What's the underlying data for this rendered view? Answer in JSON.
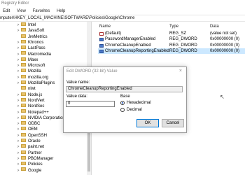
{
  "window": {
    "title": "Registry Editor"
  },
  "menu": [
    "Edit",
    "View",
    "Favorites",
    "Help"
  ],
  "address": "mputer\\HKEY_LOCAL_MACHINE\\SOFTWARE\\Policies\\Google\\Chrome",
  "tree": {
    "items": [
      {
        "label": "Intel",
        "expandable": true
      },
      {
        "label": "JavaSoft",
        "expandable": true
      },
      {
        "label": "JreMetrics",
        "expandable": false
      },
      {
        "label": "Khronos",
        "expandable": true
      },
      {
        "label": "LastPass",
        "expandable": true
      },
      {
        "label": "Macromedia",
        "expandable": true
      },
      {
        "label": "Maxx",
        "expandable": true
      },
      {
        "label": "Microsoft",
        "expandable": true
      },
      {
        "label": "Mozilla",
        "expandable": true
      },
      {
        "label": "mozilla.org",
        "expandable": true
      },
      {
        "label": "MozillaPlugins",
        "expandable": true
      },
      {
        "label": "nlwt",
        "expandable": false
      },
      {
        "label": "Node.js",
        "expandable": true
      },
      {
        "label": "NordVert",
        "expandable": true
      },
      {
        "label": "NordSec",
        "expandable": true
      },
      {
        "label": "Notepad++",
        "expandable": true
      },
      {
        "label": "NVIDIA Corporation",
        "expandable": true
      },
      {
        "label": "ODBC",
        "expandable": true
      },
      {
        "label": "OEM",
        "expandable": true
      },
      {
        "label": "OpenSSH",
        "expandable": true
      },
      {
        "label": "Oracle",
        "expandable": true
      },
      {
        "label": "paint.net",
        "expandable": true
      },
      {
        "label": "Partner",
        "expandable": true
      },
      {
        "label": "PBOManager",
        "expandable": true
      },
      {
        "label": "Policies",
        "expandable": true
      },
      {
        "label": "Google",
        "expandable": true
      }
    ]
  },
  "values": {
    "headers": {
      "name": "Name",
      "type": "Type",
      "data": "Data"
    },
    "rows": [
      {
        "name": "(Default)",
        "type": "REG_SZ",
        "data": "(value not set)",
        "icon": "string-value-icon",
        "selected": false
      },
      {
        "name": "PasswordManagerEnabled",
        "type": "REG_DWORD",
        "data": "0x00000000 (0)",
        "icon": "dword-value-icon",
        "selected": false
      },
      {
        "name": "ChromeCleanupEnabled",
        "type": "REG_DWORD",
        "data": "0x00000000 (0)",
        "icon": "dword-value-icon",
        "selected": false
      },
      {
        "name": "ChromeCleanupReportingEnabled",
        "type": "REG_DWORD",
        "data": "0x00000000 (0)",
        "icon": "dword-value-icon",
        "selected": true
      }
    ]
  },
  "dialog": {
    "title": "Edit DWORD (32-bit) Value",
    "value_name_label": "Value name:",
    "value_name": "ChromeCleanupReportingEnabled",
    "value_data_label": "Value data:",
    "value_data": "0",
    "base_label": "Base",
    "base_options": [
      "Hexadecimal",
      "Decimal"
    ],
    "base_selected": "Hexadecimal",
    "ok_label": "OK",
    "cancel_label": "Cancel",
    "close_glyph": "×"
  },
  "colors": {
    "selection": "#cce8ff",
    "folder": "#e8c26a",
    "accent": "#0078d7"
  }
}
